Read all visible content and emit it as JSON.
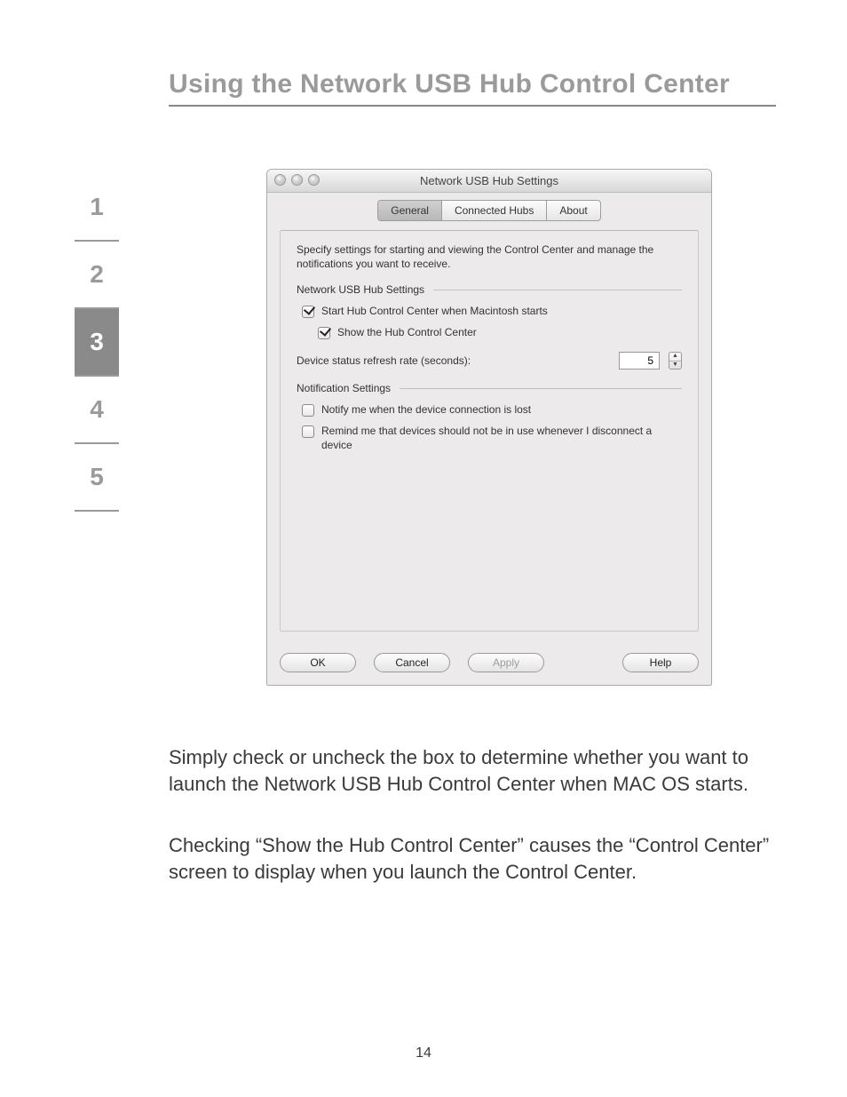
{
  "page_title": "Using the Network USB Hub Control Center",
  "side_nav": [
    "1",
    "2",
    "3",
    "4",
    "5"
  ],
  "side_nav_active_index": 2,
  "window": {
    "title": "Network USB Hub Settings",
    "tabs": [
      "General",
      "Connected Hubs",
      "About"
    ],
    "selected_tab_index": 0,
    "description": "Specify settings for starting and viewing the Control Center and manage the notifications you want to receive.",
    "section1_label": "Network USB Hub Settings",
    "cb_start_label": "Start Hub Control Center when Macintosh starts",
    "cb_start_checked": true,
    "cb_show_label": "Show the Hub Control Center",
    "cb_show_checked": true,
    "refresh_label": "Device status refresh rate (seconds):",
    "refresh_value": "5",
    "section2_label": "Notification Settings",
    "cb_notify_lost_label": "Notify me when the device connection is lost",
    "cb_notify_lost_checked": false,
    "cb_remind_label": "Remind me that devices should not be in use whenever I disconnect a device",
    "cb_remind_checked": false,
    "buttons": {
      "ok": "OK",
      "cancel": "Cancel",
      "apply": "Apply",
      "help": "Help"
    }
  },
  "paragraph1": "Simply check or uncheck the box to determine whether you want to launch the Network USB Hub Control Center when MAC OS starts.",
  "paragraph2": "Checking “Show the Hub Control Center” causes the “Control Center” screen to display when you launch the Control Center.",
  "page_number": "14"
}
